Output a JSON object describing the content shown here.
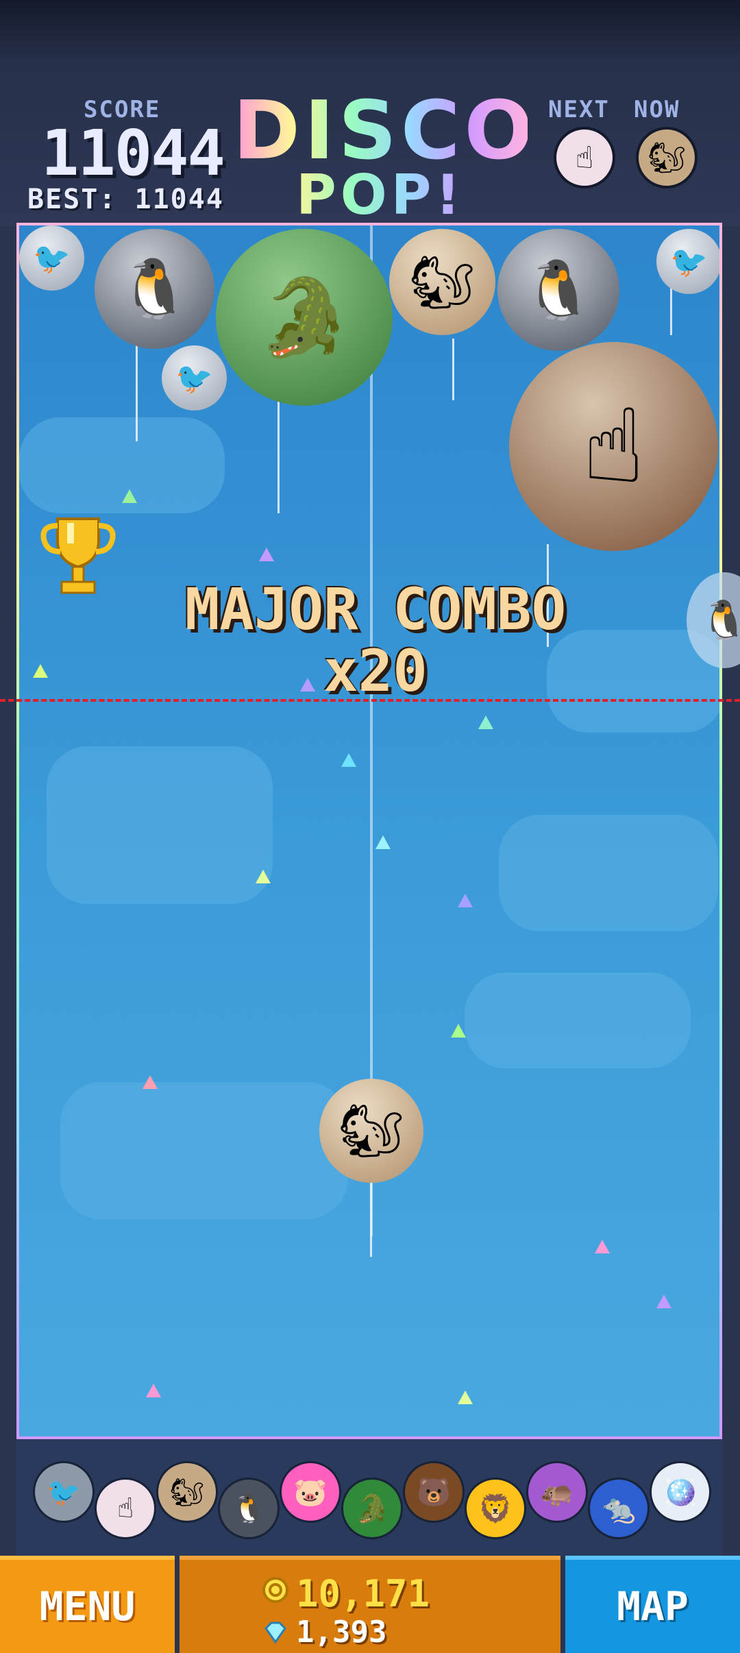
{
  "hud": {
    "score_label": "SCORE",
    "score": "11044",
    "best": "BEST: 11044",
    "title_line1": "DISCO",
    "title_line2": "POP!",
    "next_label": "NEXT",
    "now_label": "NOW",
    "next_icon": "cursor-hand-icon",
    "now_icon": "squirrel-icon",
    "next_glyph": "☝",
    "now_glyph": "🐿"
  },
  "combo": {
    "line1": "MAJOR COMBO",
    "line2": "x20"
  },
  "balloons": [
    {
      "icon": "pigeon-icon",
      "glyph": "🐦"
    },
    {
      "icon": "penguin-icon",
      "glyph": "🐧"
    },
    {
      "icon": "crocodile-icon",
      "glyph": "🐊"
    },
    {
      "icon": "squirrel-icon",
      "glyph": "🐿"
    },
    {
      "icon": "penguin-icon",
      "glyph": "🐧"
    },
    {
      "icon": "pigeon-icon",
      "glyph": "🐦"
    },
    {
      "icon": "cursor-hand-icon",
      "glyph": "☝"
    },
    {
      "icon": "pigeon-icon",
      "glyph": "🐦"
    },
    {
      "icon": "squirrel-icon",
      "glyph": "🐿"
    }
  ],
  "collection": [
    {
      "icon": "pigeon-icon",
      "glyph": "🐦",
      "color": "#8e9aa8"
    },
    {
      "icon": "cursor-hand-icon",
      "glyph": "☝",
      "color": "#f1dfe9"
    },
    {
      "icon": "squirrel-icon",
      "glyph": "🐿",
      "color": "#c6a985"
    },
    {
      "icon": "penguin-icon",
      "glyph": "🐧",
      "color": "#4a5260"
    },
    {
      "icon": "pig-icon",
      "glyph": "🐷",
      "color": "#ff5fbf"
    },
    {
      "icon": "crocodile-icon",
      "glyph": "🐊",
      "color": "#2f8a3a"
    },
    {
      "icon": "bear-icon",
      "glyph": "🐻",
      "color": "#7a4a25"
    },
    {
      "icon": "lion-icon",
      "glyph": "🦁",
      "color": "#ffc21a"
    },
    {
      "icon": "hippo-icon",
      "glyph": "🦛",
      "color": "#a35ad1"
    },
    {
      "icon": "mole-icon",
      "glyph": "🐀",
      "color": "#2d5fd0"
    },
    {
      "icon": "disco-ball-icon",
      "glyph": "🪩",
      "color": "#e8eef5"
    }
  ],
  "trophy_icon": "trophy-icon",
  "bottom": {
    "menu_label": "MENU",
    "map_label": "MAP",
    "coins": "10,171",
    "gems": "1,393",
    "coin_icon": "coin-icon",
    "gem_icon": "diamond-icon"
  },
  "colors": {
    "accent_orange": "#f39a12",
    "accent_blue": "#1497e0",
    "danger_line": "#e0202a",
    "sky": "#3b9ad8"
  }
}
